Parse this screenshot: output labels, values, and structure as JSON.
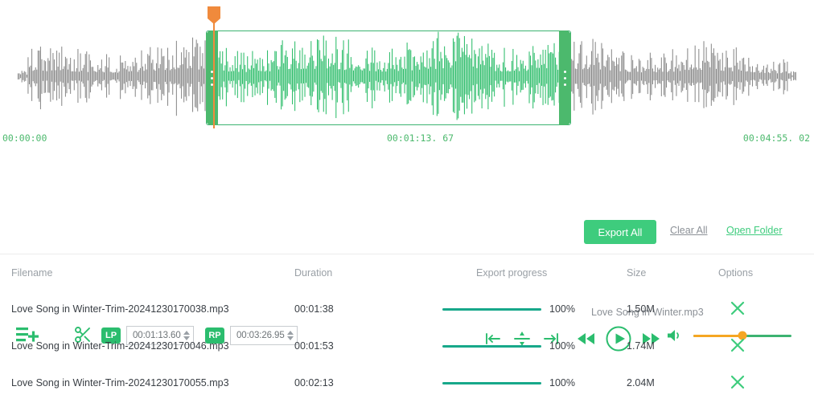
{
  "waveform": {
    "playhead_marker_icon": "playhead-flag-icon",
    "selection_left_handle_icon": "selection-left-handle",
    "selection_right_handle_icon": "selection-right-handle",
    "colors": {
      "selected_wave": "#2ebd6b",
      "unselected_wave": "#8a8a8a",
      "selection_border": "#3cb371",
      "handle": "#4cb96d",
      "playhead": "#f08a3c"
    }
  },
  "timeline": {
    "start": "00:00:00",
    "current": "00:01:13. 67",
    "end": "00:04:55. 02"
  },
  "toolbar": {
    "add_file_icon": "add-file-icon",
    "cut_icon": "scissors-icon",
    "left_point": {
      "badge": "LP",
      "value": "00:01:13.60"
    },
    "right_point": {
      "badge": "RP",
      "value": "00:03:26.95"
    }
  },
  "player": {
    "now_playing": "Love Song in Winter.mp3",
    "set_start_icon": "jump-to-start-icon",
    "split_icon": "split-icon",
    "set_end_icon": "jump-to-end-icon",
    "rewind_icon": "rewind-icon",
    "play_icon": "play-icon",
    "forward_icon": "fast-forward-icon",
    "volume_icon": "volume-icon",
    "volume_percent": 50
  },
  "actions": {
    "export_all": "Export All",
    "clear_all": "Clear All",
    "open_folder": "Open Folder"
  },
  "table": {
    "headers": {
      "filename": "Filename",
      "duration": "Duration",
      "progress": "Export progress",
      "size": "Size",
      "options": "Options"
    },
    "rows": [
      {
        "filename": "Love Song in Winter-Trim-20241230170038.mp3",
        "duration": "00:01:38",
        "progress": "100%",
        "progress_value": 100,
        "size": "1.50M",
        "delete_icon": "close-icon"
      },
      {
        "filename": "Love Song in Winter-Trim-20241230170046.mp3",
        "duration": "00:01:53",
        "progress": "100%",
        "progress_value": 100,
        "size": "1.74M",
        "delete_icon": "close-icon"
      },
      {
        "filename": "Love Song in Winter-Trim-20241230170055.mp3",
        "duration": "00:02:13",
        "progress": "100%",
        "progress_value": 100,
        "size": "2.04M",
        "delete_icon": "close-icon"
      }
    ]
  }
}
